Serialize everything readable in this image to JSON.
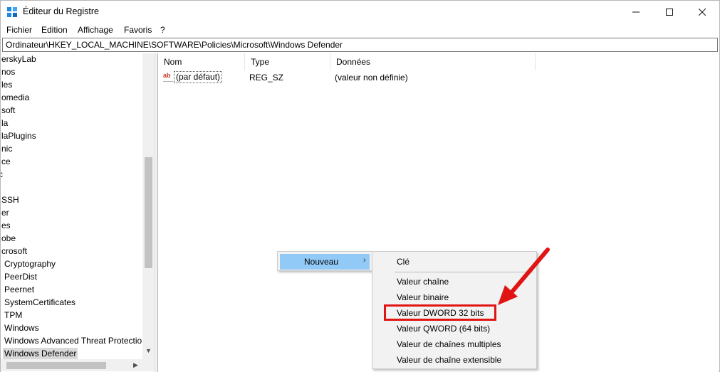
{
  "window": {
    "title": "Éditeur du Registre",
    "controls": {
      "minimize": "—",
      "maximize": "☐",
      "close": "✕"
    }
  },
  "menu": [
    "Fichier",
    "Edition",
    "Affichage",
    "Favoris",
    "?"
  ],
  "address": "Ordinateur\\HKEY_LOCAL_MACHINE\\SOFTWARE\\Policies\\Microsoft\\Windows Defender",
  "tree": {
    "items": [
      "erskyLab",
      "nos",
      "les",
      "omedia",
      "soft",
      "la",
      "laPlugins",
      "nic",
      "ce",
      "c",
      "",
      "SSH",
      "er",
      "es",
      "obe",
      "crosoft",
      "Cryptography",
      "PeerDist",
      "Peernet",
      "SystemCertificates",
      "TPM",
      "Windows",
      "Windows Advanced Threat Protectio",
      "Windows Defender"
    ],
    "selected_index": 23
  },
  "list": {
    "columns": [
      "Nom",
      "Type",
      "Données"
    ],
    "rows": [
      {
        "icon": "ab",
        "name": "(par défaut)",
        "type": "REG_SZ",
        "data": "(valeur non définie)"
      }
    ]
  },
  "context_menu": {
    "item": "Nouveau",
    "submenu": [
      "Clé",
      "Valeur chaîne",
      "Valeur binaire",
      "Valeur DWORD 32 bits",
      "Valeur QWORD (64 bits)",
      "Valeur de chaînes multiples",
      "Valeur de chaîne extensible"
    ],
    "highlighted": "Valeur DWORD 32 bits"
  },
  "colors": {
    "menu_hover": "#91c9f7",
    "annotation": "#e11414",
    "selection": "#d9d9d9"
  }
}
